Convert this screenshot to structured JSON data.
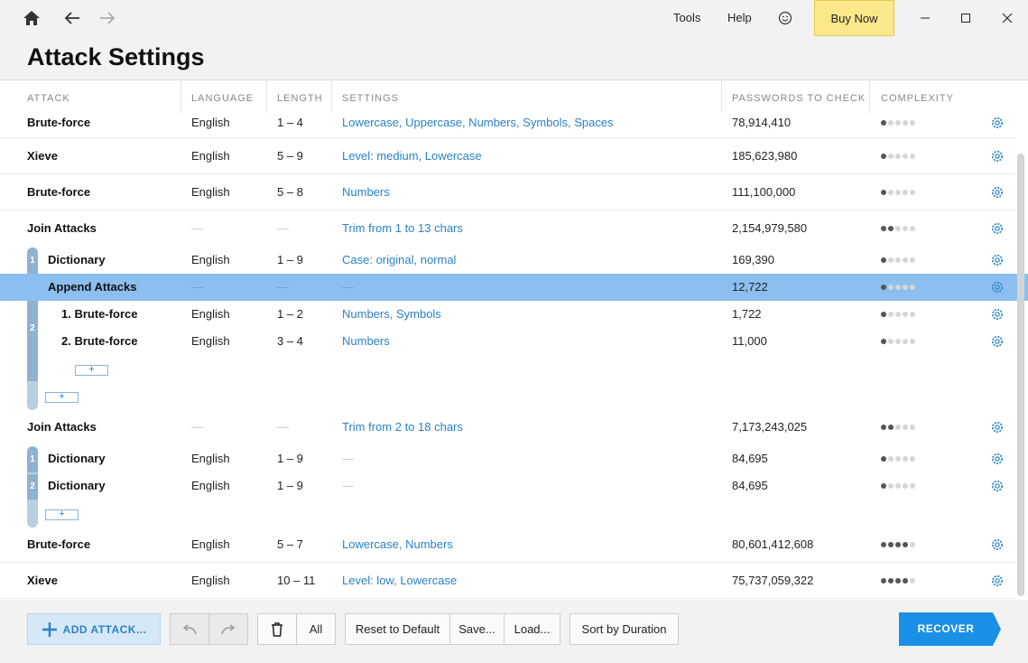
{
  "titlebar": {
    "tools": "Tools",
    "help": "Help",
    "buy_now": "Buy Now"
  },
  "page_title": "Attack Settings",
  "columns": {
    "attack": "ATTACK",
    "language": "LANGUAGE",
    "length": "LENGTH",
    "settings": "SETTINGS",
    "passwords": "PASSWORDS TO CHECK",
    "complexity": "COMPLEXITY"
  },
  "rows": [
    {
      "name": "Brute-force",
      "language": "English",
      "length": "1 – 4",
      "settings": "Lowercase, Uppercase, Numbers, Symbols, Spaces",
      "passwords": "78,914,410",
      "complexity": 1
    },
    {
      "name": "Xieve",
      "language": "English",
      "length": "5 – 9",
      "settings": "Level: medium, Lowercase",
      "passwords": "185,623,980",
      "complexity": 1
    },
    {
      "name": "Brute-force",
      "language": "English",
      "length": "5 – 8",
      "settings": "Numbers",
      "passwords": "111,100,000",
      "complexity": 1
    },
    {
      "name": "Join Attacks",
      "language": "—",
      "length": "—",
      "settings": "Trim from 1 to 13 chars",
      "passwords": "2,154,979,580",
      "complexity": 2
    },
    {
      "name": "Dictionary",
      "language": "English",
      "length": "1 – 9",
      "settings": "Case: original, normal",
      "passwords": "169,390",
      "complexity": 1
    },
    {
      "name": "Append Attacks",
      "language": "—",
      "length": "—",
      "settings": "—",
      "passwords": "12,722",
      "complexity": 1
    },
    {
      "name": "1. Brute-force",
      "language": "English",
      "length": "1 – 2",
      "settings": "Numbers, Symbols",
      "passwords": "1,722",
      "complexity": 1
    },
    {
      "name": "2. Brute-force",
      "language": "English",
      "length": "3 – 4",
      "settings": "Numbers",
      "passwords": "11,000",
      "complexity": 1
    },
    {
      "name": "Join Attacks",
      "language": "—",
      "length": "—",
      "settings": "Trim from 2 to 18 chars",
      "passwords": "7,173,243,025",
      "complexity": 2
    },
    {
      "name": "Dictionary",
      "language": "English",
      "length": "1 – 9",
      "settings": "—",
      "passwords": "84,695",
      "complexity": 1
    },
    {
      "name": "Dictionary",
      "language": "English",
      "length": "1 – 9",
      "settings": "—",
      "passwords": "84,695",
      "complexity": 1
    },
    {
      "name": "Brute-force",
      "language": "English",
      "length": "5 – 7",
      "settings": "Lowercase, Numbers",
      "passwords": "80,601,412,608",
      "complexity": 4
    },
    {
      "name": "Xieve",
      "language": "English",
      "length": "10 – 11",
      "settings": "Level: low, Lowercase",
      "passwords": "75,737,059,322",
      "complexity": 4
    }
  ],
  "brackets": {
    "group1_num1": "1",
    "group1_num2": "2",
    "group2_num1": "1",
    "group2_num2": "2",
    "plus": "+"
  },
  "bottombar": {
    "add_attack": "ADD ATTACK...",
    "all": "All",
    "reset": "Reset to Default",
    "save": "Save...",
    "load": "Load...",
    "sort": "Sort by Duration",
    "recover": "RECOVER"
  },
  "colors": {
    "accent": "#2a82c7",
    "selected_row": "#8cbff0",
    "recover_button": "#1a8fe6",
    "buy_now": "#fce78b"
  }
}
